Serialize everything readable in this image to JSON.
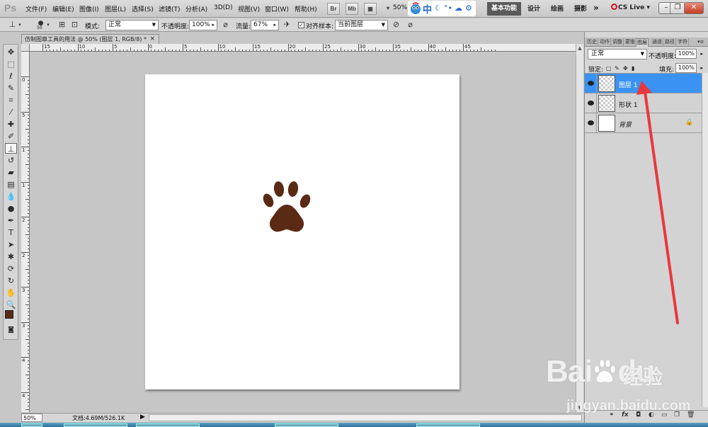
{
  "app": {
    "logo": "Ps",
    "zoom": "50%"
  },
  "menu": [
    "文件(F)",
    "编辑(E)",
    "图像(I)",
    "图层(L)",
    "选择(S)",
    "滤镜(T)",
    "分析(A)",
    "3D(D)",
    "视图(V)",
    "窗口(W)",
    "帮助(H)"
  ],
  "menubar_buttons": {
    "br": "Br",
    "mb": "Mb"
  },
  "ime": {
    "lang": "中",
    "symbols": [
      "☾",
      "°•",
      "☁",
      "⚙"
    ]
  },
  "workspaces": {
    "basic": "基本功能",
    "design": "设计",
    "paint": "绘画",
    "photo": "摄影",
    "more": "»",
    "cslive": "CS Live"
  },
  "window_controls": {
    "min": "–",
    "restore": "❐",
    "close": "✕"
  },
  "options": {
    "brush_size": "50",
    "mode_label": "模式:",
    "mode_value": "正常",
    "opacity_label": "不透明度:",
    "opacity_value": "100%",
    "flow_label": "流量:",
    "flow_value": "67%",
    "align_check": "✓",
    "align_label": "对齐",
    "sample_label": "样本:",
    "sample_value": "当前图层"
  },
  "document": {
    "tab_title": "仿制图章工具的用法 @ 50% (图层 1, RGB/8) *",
    "close": "×"
  },
  "ruler": {
    "h_labels": [
      "15",
      "10",
      "5",
      "0",
      "5",
      "10",
      "15",
      "20",
      "25",
      "30",
      "35",
      "40",
      "45"
    ],
    "v_labels": [
      "0",
      "5",
      "1",
      "1",
      "2",
      "2",
      "3",
      "3",
      "4",
      "4"
    ]
  },
  "status": {
    "zoom": "50%",
    "doc_info": "文档:4.69M/526.1K",
    "arrow": "▶"
  },
  "panel": {
    "tabs": [
      "历史",
      "动作",
      "调整",
      "蒙版",
      "图层",
      "通道",
      "路径",
      "字符"
    ],
    "active_tab": "图层",
    "blend_mode": "正常",
    "opacity_label": "不透明度:",
    "opacity_value": "100%",
    "lock_label": "锁定:",
    "fill_label": "填充:",
    "fill_value": "100%",
    "layers": [
      {
        "name": "图层 1",
        "selected": true
      },
      {
        "name": "形状 1",
        "selected": false
      },
      {
        "name": "背景",
        "selected": false
      }
    ],
    "footer_icons": [
      "link-icon",
      "fx-icon",
      "mask-icon",
      "adjustment-icon",
      "group-icon",
      "new-layer-icon",
      "trash-icon"
    ],
    "footer_labels": [
      "⚭",
      "fx",
      "◘",
      "◐",
      "▭",
      "❐",
      "🗑"
    ]
  },
  "watermark": {
    "brand": "Bai",
    "brand2": "du",
    "cn": "经验",
    "url": "jingyan.baidu.com"
  },
  "colors": {
    "foreground": "#5a2a16",
    "background": "#ffffff",
    "paw": "#5b2a14",
    "selection": "#3a93f2",
    "arrow": "#e8383d"
  }
}
